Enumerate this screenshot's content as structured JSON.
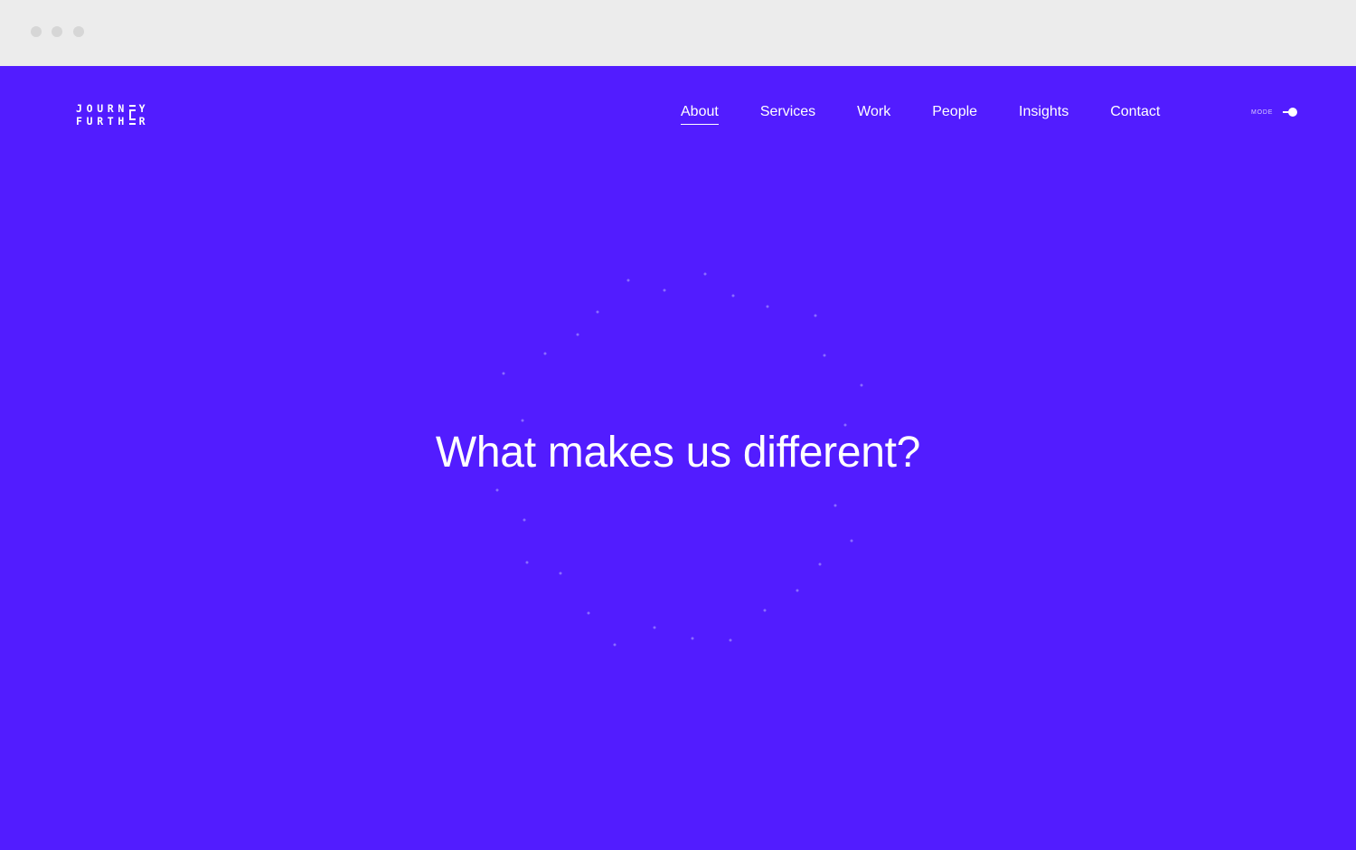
{
  "logo": {
    "row1": [
      "J",
      "O",
      "U",
      "R",
      "N",
      "E",
      "Y"
    ],
    "row2": [
      "F",
      "U",
      "R",
      "T",
      "H",
      "E",
      "R"
    ]
  },
  "nav": {
    "items": [
      {
        "label": "About",
        "active": true
      },
      {
        "label": "Services",
        "active": false
      },
      {
        "label": "Work",
        "active": false
      },
      {
        "label": "People",
        "active": false
      },
      {
        "label": "Insights",
        "active": false
      },
      {
        "label": "Contact",
        "active": false
      }
    ]
  },
  "mode": {
    "label": "MODE",
    "state": "on"
  },
  "hero": {
    "headline": "What makes us different?"
  },
  "colors": {
    "background": "#521cff",
    "text": "#ffffff",
    "chrome": "#ececec",
    "dots": "#8a6bff"
  }
}
